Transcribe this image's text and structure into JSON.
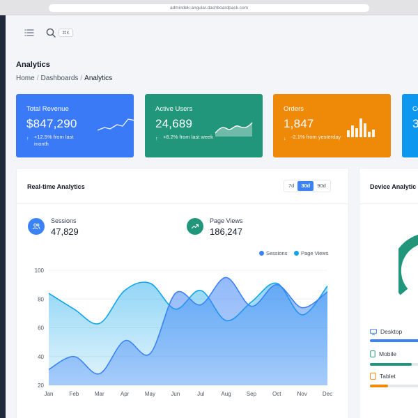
{
  "browser": {
    "url": "admindek-angular.dashboardpack.com"
  },
  "topbar": {
    "search_shortcut": "⌘K"
  },
  "page": {
    "title": "Analytics",
    "breadcrumb": [
      "Home",
      "Dashboards",
      "Analytics"
    ]
  },
  "stats": [
    {
      "label": "Total Revenue",
      "value": "$847,290",
      "change": "+12.5% from last month",
      "direction": "up",
      "color": "#3b7af6"
    },
    {
      "label": "Active Users",
      "value": "24,689",
      "change": "+8.2% from last week",
      "direction": "up",
      "color": "#22967a"
    },
    {
      "label": "Orders",
      "value": "1,847",
      "change": "-2.1% from yesterday",
      "direction": "down",
      "color": "#ee8a08"
    },
    {
      "label": "Co",
      "value": "3",
      "change": "",
      "direction": "up",
      "color": "#0d97ee"
    }
  ],
  "realtime": {
    "title": "Real-time Analytics",
    "ranges": [
      "7d",
      "30d",
      "90d"
    ],
    "active_range": "30d",
    "metrics": [
      {
        "label": "Sessions",
        "value": "47,829",
        "icon": "users-icon",
        "color": "#3b82f6"
      },
      {
        "label": "Page Views",
        "value": "186,247",
        "icon": "trending-up-icon",
        "color": "#22967a"
      }
    ],
    "legend": [
      {
        "name": "Sessions",
        "color": "#3b82f6"
      },
      {
        "name": "Page Views",
        "color": "#0ea5e9"
      }
    ]
  },
  "chart_data": {
    "type": "area",
    "categories": [
      "Jan",
      "Feb",
      "Mar",
      "Apr",
      "May",
      "Jun",
      "Jul",
      "Aug",
      "Sep",
      "Oct",
      "Nov",
      "Dec"
    ],
    "ylim": [
      20,
      100
    ],
    "yticks": [
      20,
      40,
      60,
      80,
      100
    ],
    "grid": true,
    "legend_position": "top-right",
    "series": [
      {
        "name": "Sessions",
        "color": "#3b82f6",
        "values": [
          31,
          40,
          28,
          51,
          42,
          84,
          76,
          95,
          75,
          90,
          74,
          85
        ]
      },
      {
        "name": "Page Views",
        "color": "#0ea5e9",
        "values": [
          84,
          73,
          63,
          86,
          91,
          73,
          86,
          65,
          78,
          91,
          69,
          89
        ]
      }
    ]
  },
  "device": {
    "title": "Device Analytic",
    "items": [
      {
        "label": "Desktop",
        "icon": "monitor-icon",
        "color": "#3b82f6",
        "fill": 0.62
      },
      {
        "label": "Mobile",
        "icon": "smartphone-icon",
        "color": "#22967a",
        "fill": 0.5
      },
      {
        "label": "Tablet",
        "icon": "tablet-icon",
        "color": "#ee8a08",
        "fill": 0.22
      }
    ]
  }
}
